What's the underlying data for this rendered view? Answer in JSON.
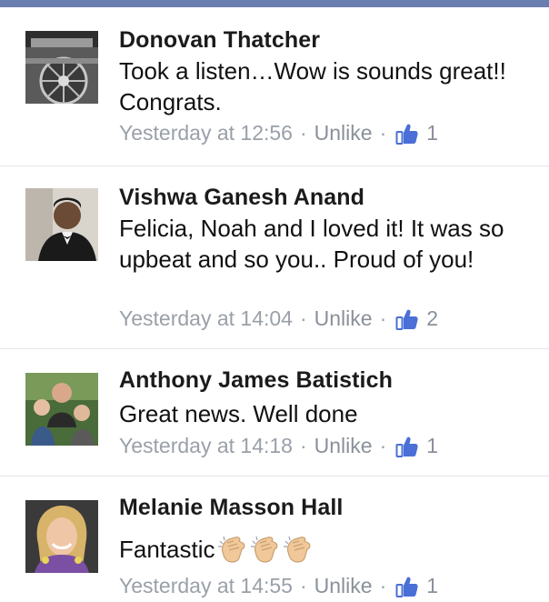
{
  "comments": [
    {
      "author": "Donovan Thatcher",
      "text": "Took a listen…Wow is sounds great!! Congrats.",
      "time": "Yesterday at 12:56",
      "separator": "·",
      "action": "Unlike",
      "likes": "1",
      "avatar_icon": "train-wheel-photo"
    },
    {
      "author": "Vishwa Ganesh Anand",
      "text": "Felicia, Noah and I loved it! It was so upbeat and so you.. Proud of you!",
      "time": "Yesterday at 14:04",
      "separator": "·",
      "action": "Unlike",
      "likes": "2",
      "avatar_icon": "man-in-tuxedo-photo"
    },
    {
      "author": "Anthony James Batistich",
      "text": "Great news. Well done",
      "time": "Yesterday at 14:18",
      "separator": "·",
      "action": "Unlike",
      "likes": "1",
      "avatar_icon": "family-photo"
    },
    {
      "author": "Melanie Masson Hall",
      "text": "Fantastic",
      "emojis": [
        "clapping-hands",
        "clapping-hands",
        "clapping-hands"
      ],
      "time": "Yesterday at 14:55",
      "separator": "·",
      "action": "Unlike",
      "likes": "1",
      "avatar_icon": "smiling-woman-photo"
    }
  ],
  "colors": {
    "like_blue": "#4a6fd6",
    "meta_gray": "#9aa0a8",
    "divider": "#e2e4e8",
    "topbar": "#6a7fb0"
  }
}
